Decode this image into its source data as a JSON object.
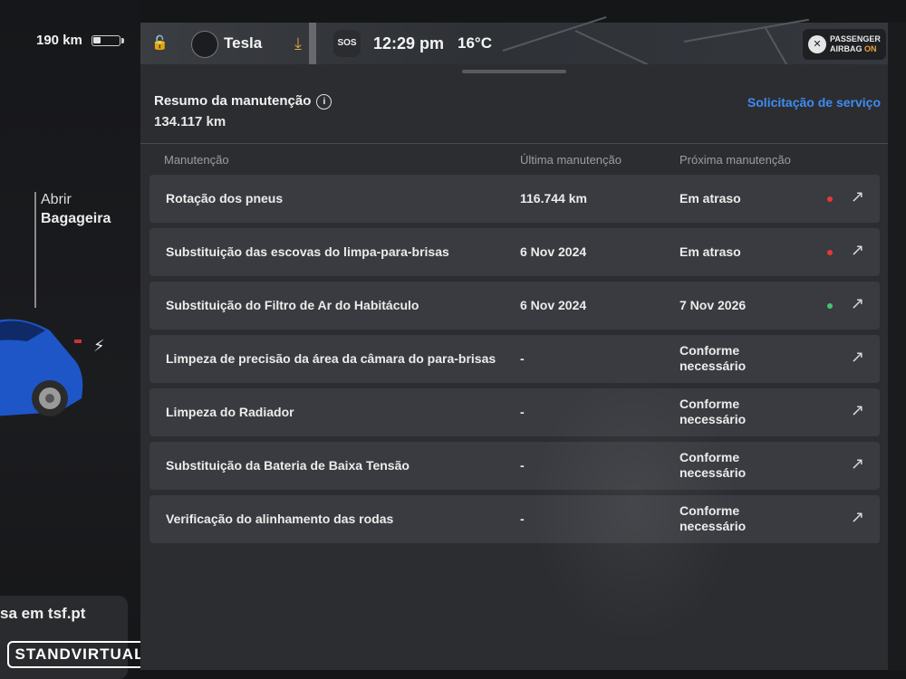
{
  "status": {
    "range": "190 km",
    "battery_level": 0.3,
    "profile": "Tesla",
    "sos": "SOS",
    "time": "12:29 pm",
    "temperature": "16°C",
    "airbag_line1": "PASSENGER",
    "airbag_line2": "AIRBAG",
    "airbag_state": "ON"
  },
  "side": {
    "trunk_line1": "Abrir",
    "trunk_line2": "Bagageira",
    "promo": "sa em tsf.pt",
    "watermark": "STANDVIRTUAL"
  },
  "summary": {
    "title": "Resumo da manutenção",
    "odometer": "134.117  km",
    "service_link": "Solicitação de serviço"
  },
  "table": {
    "headers": [
      "Manutenção",
      "Última manutenção",
      "Próxima manutenção"
    ],
    "rows": [
      {
        "name": "Rotação dos pneus",
        "last": "116.744 km",
        "next": "Em atraso",
        "next2": "",
        "status_color": "#e53935"
      },
      {
        "name": "Substituição das escovas do limpa-para-brisas",
        "last": "6 Nov 2024",
        "next": "Em atraso",
        "next2": "",
        "status_color": "#e53935"
      },
      {
        "name": "Substituição do Filtro de Ar do Habitáculo",
        "last": "6 Nov 2024",
        "next": "7 Nov 2026",
        "next2": "",
        "status_color": "#43c56b"
      },
      {
        "name": "Limpeza de precisão da área da câmara do para-brisas",
        "last": "-",
        "next": "Conforme",
        "next2": "necessário",
        "status_color": ""
      },
      {
        "name": "Limpeza do Radiador",
        "last": "-",
        "next": "Conforme",
        "next2": "necessário",
        "status_color": ""
      },
      {
        "name": "Substituição da Bateria de Baixa Tensão",
        "last": "-",
        "next": "Conforme",
        "next2": "necessário",
        "status_color": ""
      },
      {
        "name": "Verificação do alinhamento das rodas",
        "last": "-",
        "next": "Conforme",
        "next2": "necessário",
        "status_color": ""
      }
    ]
  },
  "icons": {
    "lock": "lock-open-icon",
    "download": "download-icon",
    "info": "info-icon",
    "arrow": "external-arrow-icon",
    "bolt": "charging-bolt-icon"
  }
}
